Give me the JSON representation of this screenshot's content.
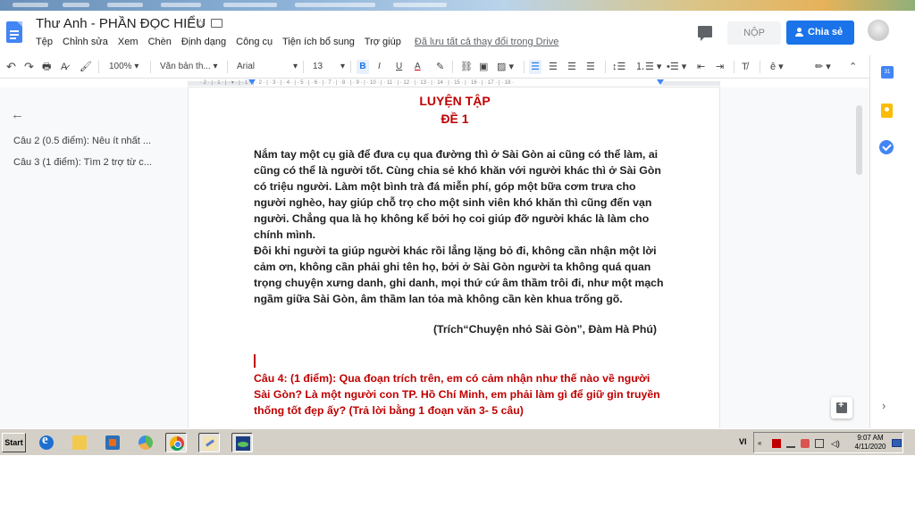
{
  "doc": {
    "title": "Thư Anh - PHẦN ĐỌC HIỂU",
    "menu": [
      "Tệp",
      "Chỉnh sửa",
      "Xem",
      "Chèn",
      "Định dạng",
      "Công cụ",
      "Tiện ích bổ sung",
      "Trợ giúp"
    ],
    "saved_status": "Đã lưu tất cả thay đổi trong Drive",
    "submit_label": "NỘP",
    "share_label": "Chia sẻ"
  },
  "toolbar": {
    "zoom": "100%",
    "style": "Văn bản th...",
    "font": "Arial",
    "font_size": "13",
    "bold": "B",
    "italic": "I",
    "underline": "U",
    "text_color": "A"
  },
  "ruler": {
    "marks": "· 2 · | · 1 · | · ▾ · | · 1 · | · 2 · | · 3 · | · 4 · | · 5 · | · 6 · | · 7 · | · 8 · | · 9 · | · 10 · | · 11 · | · 12 · | · 13 · | · 14 · | · 15 · | · 16 · | · 17 · | · 18 ·"
  },
  "outline": {
    "items": [
      "Câu 2 (0.5 điểm): Nêu ít nhất ...",
      "Câu 3 (1 điểm): Tìm 2 trợ từ c..."
    ]
  },
  "page": {
    "heading1": "LUYỆN TẬP",
    "heading2": "ĐỀ 1",
    "paragraph1": "Nắm tay một cụ già để đưa cụ qua đường thì ở Sài Gòn ai cũng có thể làm, ai cũng có thể là người tốt. Cùng chia sẻ khó khăn với người khác thì ở Sài Gòn có triệu người. Làm một bình trà đá miễn phí, góp một bữa cơm trưa cho người nghèo, hay giúp chỗ trọ cho một sinh viên khó khăn thì cũng đến vạn người. Chẳng qua là họ không kể bởi họ coi giúp đỡ người khác là làm cho chính mình.",
    "paragraph2": "Đôi khi người ta giúp người khác rồi lẳng lặng bỏ đi, không cần nhận một lời cảm ơn, không cần phải ghi tên họ, bởi ở Sài Gòn người ta không quá quan trọng chuyện xưng danh, ghi danh, mọi thứ cứ âm thầm trôi đi, như một mạch ngầm giữa Sài Gòn, âm thầm lan tỏa mà không cần kèn khua trống gõ.",
    "citation": "(Trích“Chuyện nhỏ Sài Gòn”, Đàm Hà Phú)",
    "question": "Câu 4: (1 điểm): Qua đoạn trích trên, em có cảm nhận như thế nào về người Sài Gòn? Là một người con TP. Hồ Chí Minh, em phải làm gì để giữ gìn truyền thống tốt đẹp ấy? (Trả lời bằng 1 đoạn văn 3- 5 câu)"
  },
  "side_panel": {
    "calendar_day": "31"
  },
  "taskbar": {
    "start_label": "Start",
    "language": "VI",
    "clock_time": "9:07 AM",
    "clock_date": "4/11/2020"
  },
  "colors": {
    "accent": "#1a73e8",
    "heading_red": "#c00000",
    "taskbar": "#d4d0c8"
  }
}
